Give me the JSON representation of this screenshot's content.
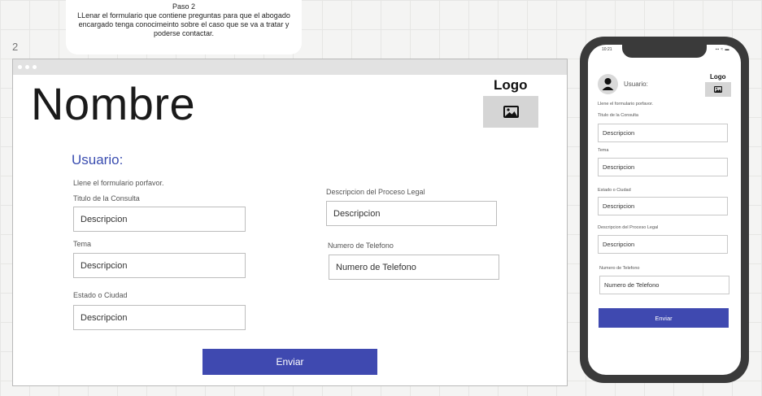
{
  "note": {
    "step": "Paso 2",
    "description": "LLenar el formulario que contiene preguntas para que el abogado encargado tenga conocimeinto sobre el caso que se va a tratar y poderse contactar."
  },
  "frame_number": "2",
  "desktop": {
    "title": "Nombre",
    "logo_label": "Logo",
    "user_label": "Usuario:",
    "instruction": "Llene el formulario porfavor.",
    "fields": {
      "titulo": {
        "label": "Titulo de la Consulta",
        "placeholder": "Descripcion"
      },
      "tema": {
        "label": "Tema",
        "placeholder": "Descripcion"
      },
      "estado": {
        "label": "Estado o Ciudad",
        "placeholder": "Descripcion"
      },
      "proceso": {
        "label": "Descripcion del Proceso Legal",
        "placeholder": "Descripcion"
      },
      "telefono": {
        "label": "Numero de Telefono",
        "placeholder": "Numero de Telefono"
      }
    },
    "submit": "Enviar"
  },
  "mobile": {
    "time": "10:21",
    "user_label": "Usuario:",
    "logo_label": "Logo",
    "instruction": "Llene el formulario porfavor.",
    "fields": {
      "titulo": {
        "label": "Titulo de la Consulta",
        "placeholder": "Descripcion"
      },
      "tema": {
        "label": "Tema",
        "placeholder": "Descripcion"
      },
      "estado": {
        "label": "Estado o Ciudad",
        "placeholder": "Descripcion"
      },
      "proceso": {
        "label": "Descripcion del Proceso Legal",
        "placeholder": "Descripcion"
      },
      "telefono": {
        "label": "Numero de Telefono",
        "placeholder": "Numero de Telefono"
      }
    },
    "submit": "Enviar"
  },
  "colors": {
    "accent": "#3f49b0",
    "user_label": "#3a4db0",
    "logo_placeholder": "#d5d5d5"
  },
  "icons": {
    "logo": "image-icon",
    "avatar": "user-icon"
  }
}
